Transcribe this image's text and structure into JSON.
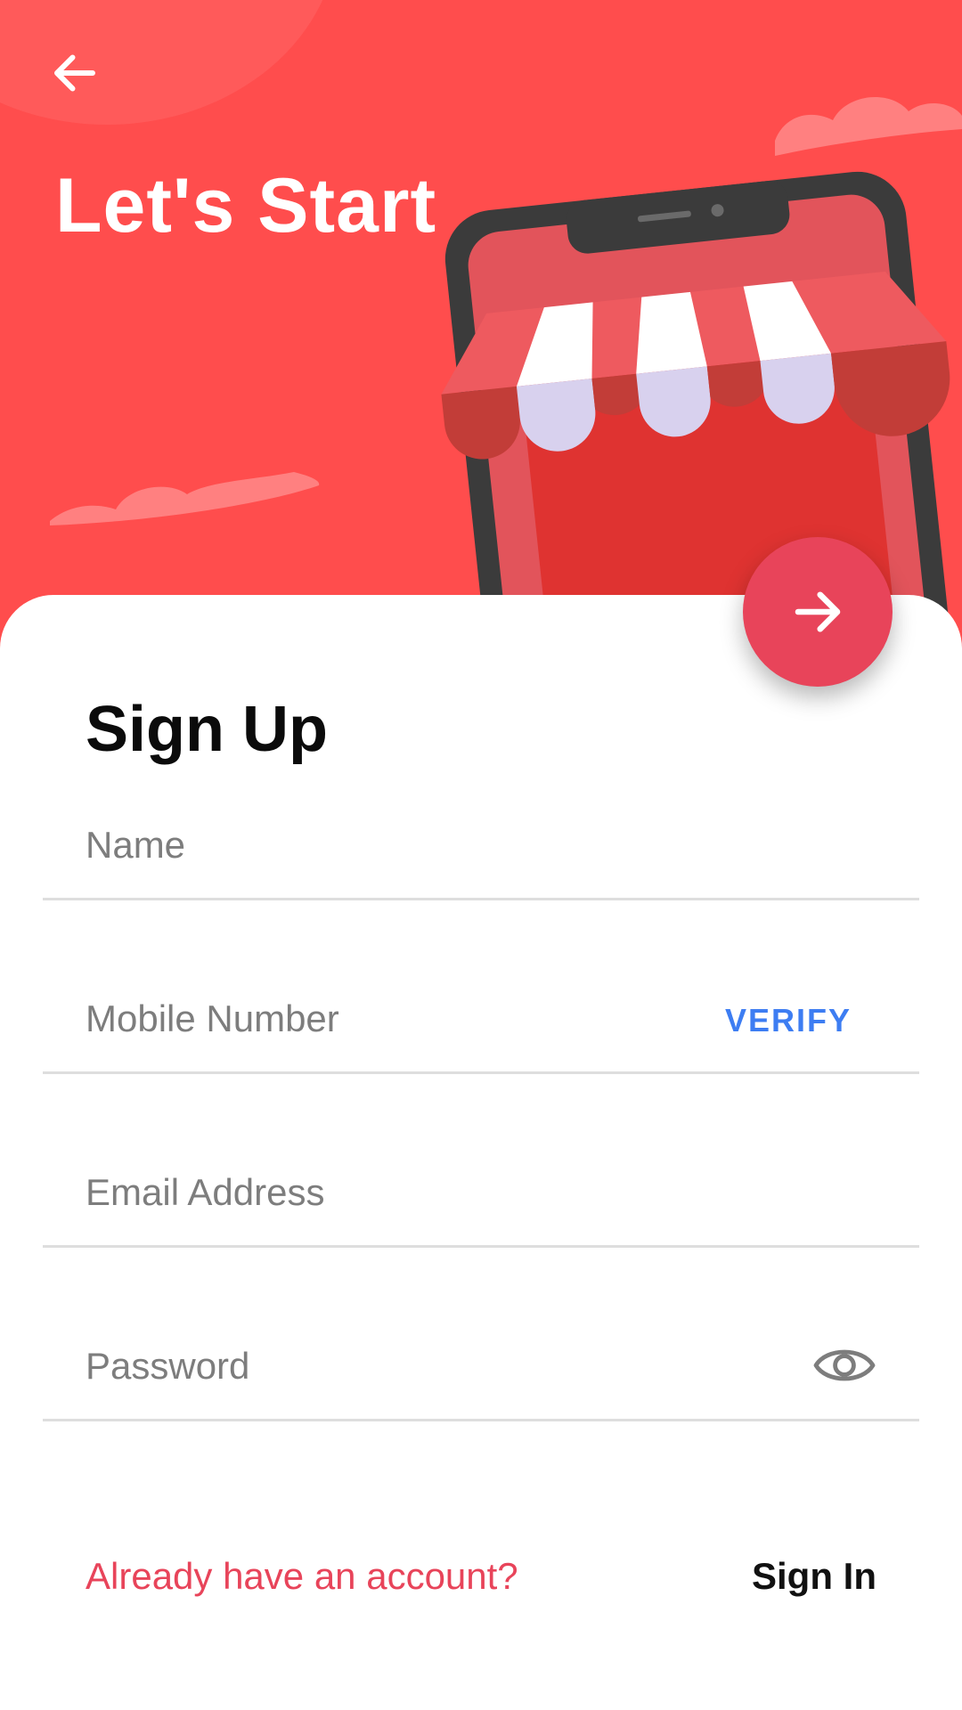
{
  "header": {
    "title": "Let's Start",
    "back_icon": "arrow-left-icon"
  },
  "fab": {
    "icon": "arrow-right-icon",
    "color": "#e8445a"
  },
  "form": {
    "title": "Sign Up",
    "fields": {
      "name": {
        "placeholder": "Name",
        "value": ""
      },
      "mobile": {
        "placeholder": "Mobile Number",
        "value": "",
        "action_label": "VERIFY"
      },
      "email": {
        "placeholder": "Email Address",
        "value": ""
      },
      "password": {
        "placeholder": "Password",
        "value": "",
        "toggle_icon": "eye-icon"
      }
    }
  },
  "footer": {
    "prompt": "Already have an account?",
    "link_label": "Sign In"
  },
  "colors": {
    "hero_background": "#ff4d4d",
    "accent": "#e8445a",
    "link_blue": "#3d7df2"
  }
}
